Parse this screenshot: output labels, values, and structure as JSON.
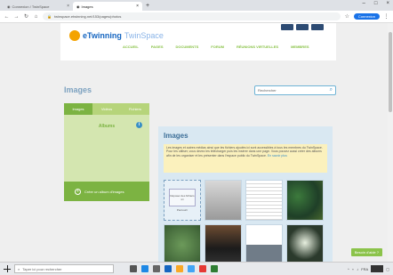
{
  "browser": {
    "tabs": [
      {
        "label": "Connexion / TwinSpace",
        "active": false
      },
      {
        "label": "Images",
        "active": true
      }
    ],
    "url": "twinspace.etwinning.net/153/pages/photos",
    "profile": "Connexion"
  },
  "site": {
    "logo": {
      "part1": "eTwinning",
      "part2": "TwinSpace"
    },
    "nav": [
      "ACCUEIL",
      "PAGES",
      "DOCUMENTS",
      "FORUM",
      "RÉUNIONS VIRTUELLES",
      "MEMBRES"
    ]
  },
  "page": {
    "title": "Images",
    "search_placeholder": "Rechercher"
  },
  "left_panel": {
    "tabs": [
      "Images",
      "Vidéos",
      "Fichiers"
    ],
    "section": "Albums",
    "create_button": "Créer un album d'images"
  },
  "main": {
    "title": "Images",
    "notice": "Les images et autres médias ainsi que les fichiers ajoutés ici sont accessibles à tous les membres du TwinSpace. Pour les utiliser, vous devez les télécharger puis les insérer dans une page. Vous pouvez aussi créer des albums afin de les organiser et les présenter dans l'espace public du TwinSpace.",
    "notice_link": "En savoir plus",
    "upload_label": "Déposer des fichiers ici",
    "upload_sub": "Parcourir"
  },
  "chat_label": "Besoin d'aide ?",
  "taskbar": {
    "search_placeholder": "Taper ici pour rechercher",
    "lang": "FRA"
  },
  "colors": {
    "accent_green": "#7cb342",
    "title_blue": "#3d6f98"
  }
}
